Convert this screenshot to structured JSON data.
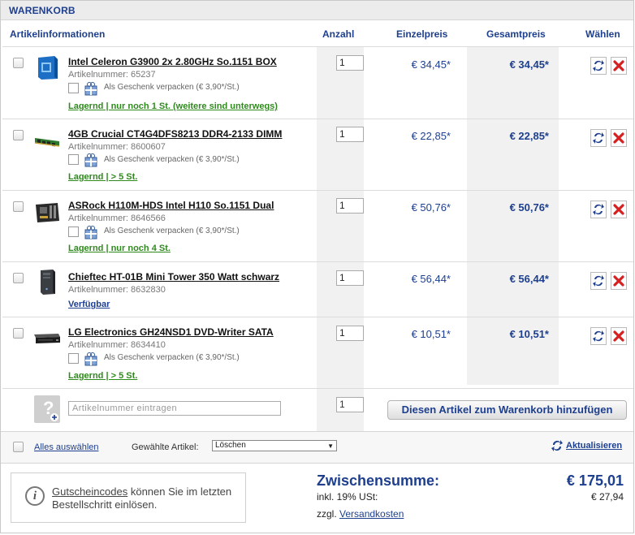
{
  "header": {
    "title": "WARENKORB"
  },
  "columns": {
    "artikel": "Artikelinformationen",
    "anzahl": "Anzahl",
    "einzelpreis": "Einzelpreis",
    "gesamtpreis": "Gesamtpreis",
    "waehlen": "Wählen"
  },
  "items": [
    {
      "name": "Intel Celeron G3900 2x 2.80GHz So.1151 BOX",
      "artnr": "Artikelnummer: 65237",
      "gift": "Als Geschenk verpacken (€ 3,90*/St.)",
      "stock": "Lagernd | nur noch 1 St. (weitere sind unterwegs)",
      "qty": "1",
      "einzel": "€ 34,45*",
      "gesamt": "€ 34,45*",
      "thumb": "cpu-box"
    },
    {
      "name": "4GB Crucial CT4G4DFS8213 DDR4-2133 DIMM",
      "artnr": "Artikelnummer: 8600607",
      "gift": "Als Geschenk verpacken (€ 3,90*/St.)",
      "stock": "Lagernd | > 5 St.",
      "qty": "1",
      "einzel": "€ 22,85*",
      "gesamt": "€ 22,85*",
      "thumb": "ram-module"
    },
    {
      "name": "ASRock H110M-HDS Intel H110 So.1151 Dual",
      "artnr": "Artikelnummer: 8646566",
      "gift": "Als Geschenk verpacken (€ 3,90*/St.)",
      "stock": "Lagernd | nur noch 4 St.",
      "qty": "1",
      "einzel": "€ 50,76*",
      "gesamt": "€ 50,76*",
      "thumb": "motherboard"
    },
    {
      "name": "Chieftec HT-01B Mini Tower 350 Watt schwarz",
      "artnr": "Artikelnummer: 8632830",
      "gift": "",
      "stock": "Verfügbar",
      "qty": "1",
      "einzel": "€ 56,44*",
      "gesamt": "€ 56,44*",
      "thumb": "pc-tower"
    },
    {
      "name": "LG Electronics GH24NSD1 DVD-Writer SATA",
      "artnr": "Artikelnummer: 8634410",
      "gift": "Als Geschenk verpacken (€ 3,90*/St.)",
      "stock": "Lagernd | > 5 St.",
      "qty": "1",
      "einzel": "€ 10,51*",
      "gesamt": "€ 10,51*",
      "thumb": "dvd-drive"
    }
  ],
  "add_row": {
    "placeholder": "Artikelnummer eintragen",
    "qty": "1",
    "button": "Diesen Artikel zum Warenkorb hinzufügen"
  },
  "actions": {
    "select_all": "Alles auswählen",
    "selected_label": "Gewählte Artikel:",
    "selected_value": "Löschen",
    "update": "Aktualisieren"
  },
  "voucher": {
    "link": "Gutscheincodes",
    "text": " können Sie im letzten Bestellschritt einlösen."
  },
  "summary": {
    "subtotal_label": "Zwischensumme:",
    "subtotal_value": "€ 175,01",
    "vat_label": "inkl. 19% USt:",
    "vat_value": "€ 27,94",
    "shipping_prefix": "zzgl. ",
    "shipping_link": "Versandkosten"
  },
  "colors": {
    "accent": "#1d3f8e",
    "stock_green": "#2f8a1d",
    "delete_red": "#d42020"
  }
}
